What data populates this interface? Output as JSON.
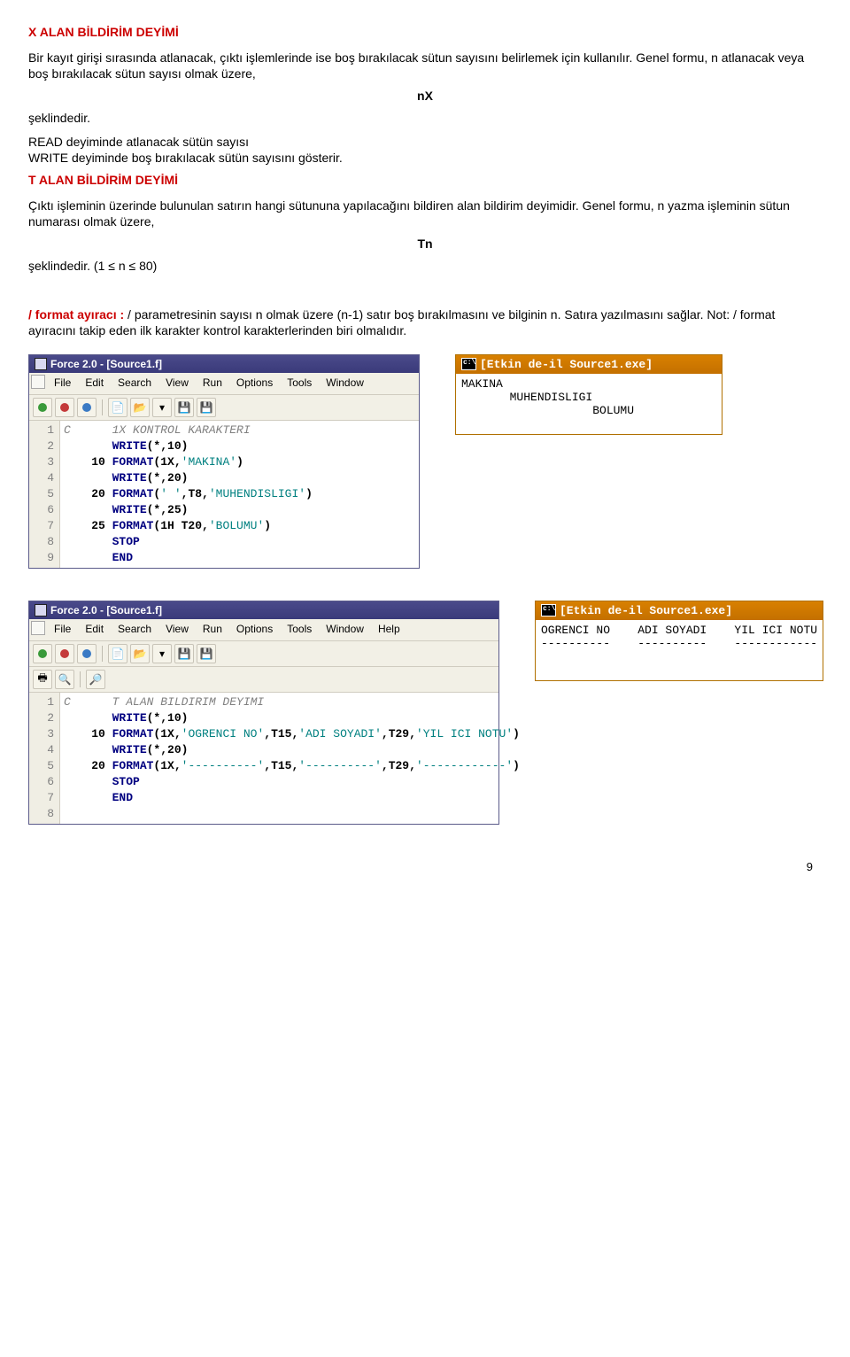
{
  "heading_x": "X ALAN BİLDİRİM DEYİMİ",
  "para1": "Bir kayıt girişi sırasında atlanacak, çıktı işlemlerinde ise boş bırakılacak sütun sayısını belirlemek için kullanılır. Genel formu, n atlanacak veya boş bırakılacak sütun sayısı olmak üzere,",
  "nx_label": "nX",
  "seklindedir": "şeklindedir.",
  "para2": "READ deyiminde atlanacak sütün sayısı",
  "para3": "WRITE deyiminde boş bırakılacak sütün sayısını gösterir.",
  "heading_t": "T ALAN BİLDİRİM DEYİMİ",
  "para4": "Çıktı işleminin üzerinde bulunulan satırın hangi sütununa yapılacağını bildiren alan bildirim deyimidir. Genel formu, n yazma işleminin sütun numarası olmak üzere,",
  "tn_label": "Tn",
  "seklindedir2": "şeklindedir. (1 ≤ n ≤ 80)",
  "format_lead": "/ format ayıracı : ",
  "format_para": "/ parametresinin sayısı n olmak üzere (n-1) satır boş bırakılmasını ve bilginin n. Satıra yazılmasını sağlar. Not: / format ayıracını takip eden ilk karakter kontrol karakterlerinden biri olmalıdır.",
  "ide1": {
    "title": "Force 2.0 - [Source1.f]",
    "menus": [
      "File",
      "Edit",
      "Search",
      "View",
      "Run",
      "Options",
      "Tools",
      "Window"
    ],
    "lines": [
      {
        "n": "1",
        "t": "cmt",
        "text": "C      1X KONTROL KARAKTERI"
      },
      {
        "n": "2",
        "t": "mix",
        "pre": "       ",
        "kw": "WRITE",
        "rest": "(*,10)"
      },
      {
        "n": "3",
        "t": "fmt",
        "pre": "    10 ",
        "kw": "FORMAT",
        "rest": "(1X,",
        "str": "'MAKINA'",
        "rest2": ")"
      },
      {
        "n": "4",
        "t": "mix",
        "pre": "       ",
        "kw": "WRITE",
        "rest": "(*,20)"
      },
      {
        "n": "5",
        "t": "fmt",
        "pre": "    20 ",
        "kw": "FORMAT",
        "rest": "(",
        "str": "' '",
        "mid": ",T8,",
        "str2": "'MUHENDISLIGI'",
        "rest2": ")"
      },
      {
        "n": "6",
        "t": "mix",
        "pre": "       ",
        "kw": "WRITE",
        "rest": "(*,25)"
      },
      {
        "n": "7",
        "t": "fmt",
        "pre": "    25 ",
        "kw": "FORMAT",
        "rest": "(1H T20,",
        "str": "'BOLUMU'",
        "rest2": ")"
      },
      {
        "n": "8",
        "t": "kw",
        "pre": "       ",
        "kw": "STOP"
      },
      {
        "n": "9",
        "t": "kw",
        "pre": "       ",
        "kw": "END"
      }
    ]
  },
  "console1": {
    "title": "[Etkin de-il Source1.exe]",
    "body": "MAKINA\n       MUHENDISLIGI\n                   BOLUMU"
  },
  "ide2": {
    "title": "Force 2.0 - [Source1.f]",
    "menus": [
      "File",
      "Edit",
      "Search",
      "View",
      "Run",
      "Options",
      "Tools",
      "Window",
      "Help"
    ],
    "lines": [
      {
        "n": "1",
        "t": "cmt",
        "text": "C      T ALAN BILDIRIM DEYIMI"
      },
      {
        "n": "2",
        "t": "mix",
        "pre": "       ",
        "kw": "WRITE",
        "rest": "(*,10)"
      },
      {
        "n": "3",
        "t": "fmt",
        "pre": "    10 ",
        "kw": "FORMAT",
        "rest": "(1X,",
        "str": "'OGRENCI NO'",
        "mid": ",T15,",
        "str2": "'ADI SOYADI'",
        "mid2": ",T29,",
        "str3": "'YIL ICI NOTU'",
        "rest2": ")"
      },
      {
        "n": "4",
        "t": "mix",
        "pre": "       ",
        "kw": "WRITE",
        "rest": "(*,20)"
      },
      {
        "n": "5",
        "t": "fmt",
        "pre": "    20 ",
        "kw": "FORMAT",
        "rest": "(1X,",
        "str": "'----------'",
        "mid": ",T15,",
        "str2": "'----------'",
        "mid2": ",T29,",
        "str3": "'------------'",
        "rest2": ")"
      },
      {
        "n": "6",
        "t": "kw",
        "pre": "       ",
        "kw": "STOP"
      },
      {
        "n": "7",
        "t": "kw",
        "pre": "       ",
        "kw": "END"
      },
      {
        "n": "8",
        "t": "empty",
        "text": ""
      }
    ]
  },
  "console2": {
    "title": "[Etkin de-il Source1.exe]",
    "body": "OGRENCI NO    ADI SOYADI    YIL ICI NOTU\n----------    ----------    ------------"
  },
  "page_number": "9"
}
